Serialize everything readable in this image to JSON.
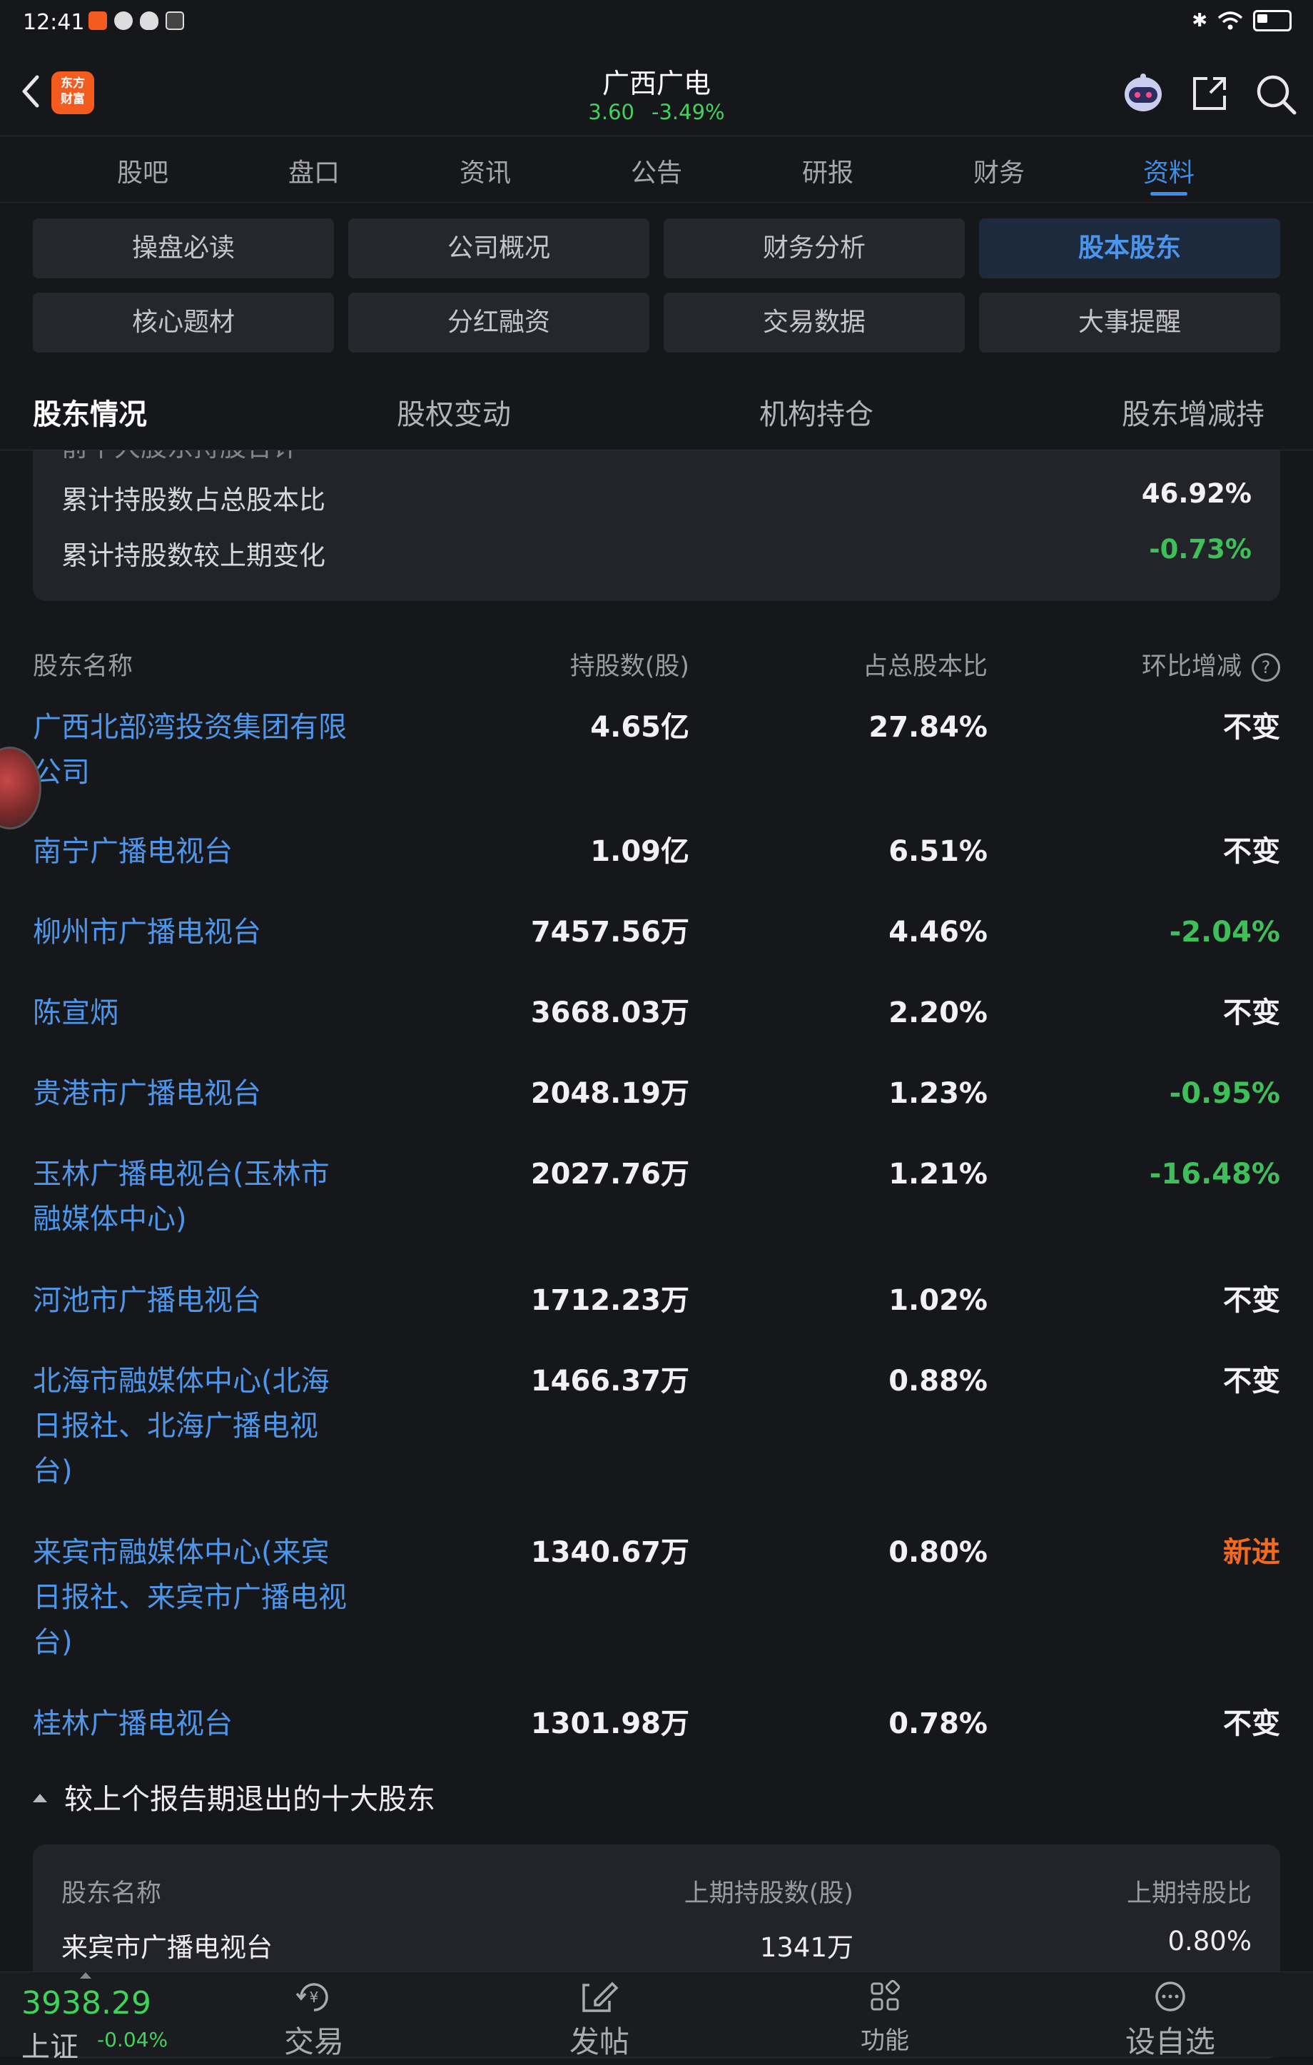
{
  "status_bar": {
    "time": "12:41"
  },
  "header": {
    "logo_text_1": "东方",
    "logo_text_2": "财富",
    "stock_name": "广西广电",
    "price": "3.60",
    "change_pct": "-3.49%"
  },
  "main_tabs": [
    "股吧",
    "盘口",
    "资讯",
    "公告",
    "研报",
    "财务",
    "资料"
  ],
  "main_tabs_active": "资料",
  "sub_buttons": [
    "操盘必读",
    "公司概况",
    "财务分析",
    "股本股东",
    "核心题材",
    "分红融资",
    "交易数据",
    "大事提醒"
  ],
  "sub_buttons_active": "股本股东",
  "section_tabs": [
    "股东情况",
    "股权变动",
    "机构持仓",
    "股东增减持"
  ],
  "section_tabs_active": "股东情况",
  "summary": [
    {
      "label": "前十大股东持股合计",
      "value": ""
    },
    {
      "label": "累计持股数占总股本比",
      "value": "46.92%"
    },
    {
      "label": "累计持股数较上期变化",
      "value": "-0.73%"
    }
  ],
  "table_headers": {
    "name": "股东名称",
    "shares": "持股数(股)",
    "ratio": "占总股本比",
    "change": "环比增减"
  },
  "holders": [
    {
      "name": "广西北部湾投资集团有限公司",
      "shares": "4.65亿",
      "ratio": "27.84%",
      "change": "不变"
    },
    {
      "name": "南宁广播电视台",
      "shares": "1.09亿",
      "ratio": "6.51%",
      "change": "不变"
    },
    {
      "name": "柳州市广播电视台",
      "shares": "7457.56万",
      "ratio": "4.46%",
      "change": "-2.04%"
    },
    {
      "name": "陈宣炳",
      "shares": "3668.03万",
      "ratio": "2.20%",
      "change": "不变"
    },
    {
      "name": "贵港市广播电视台",
      "shares": "2048.19万",
      "ratio": "1.23%",
      "change": "-0.95%"
    },
    {
      "name": "玉林广播电视台(玉林市融媒体中心)",
      "shares": "2027.76万",
      "ratio": "1.21%",
      "change": "-16.48%"
    },
    {
      "name": "河池市广播电视台",
      "shares": "1712.23万",
      "ratio": "1.02%",
      "change": "不变"
    },
    {
      "name": "北海市融媒体中心(北海日报社、北海广播电视台)",
      "shares": "1466.37万",
      "ratio": "0.88%",
      "change": "不变"
    },
    {
      "name": "来宾市融媒体中心(来宾日报社、来宾市广播电视台)",
      "shares": "1340.67万",
      "ratio": "0.80%",
      "change": "新进"
    },
    {
      "name": "桂林广播电视台",
      "shares": "1301.98万",
      "ratio": "0.78%",
      "change": "不变"
    }
  ],
  "exited": {
    "title": "较上个报告期退出的十大股东",
    "headers": {
      "name": "股东名称",
      "prev_shares": "上期持股数(股)",
      "prev_ratio": "上期持股比"
    },
    "rows": [
      {
        "name": "来宾市广播电视台",
        "prev_shares": "1341万",
        "prev_ratio": "0.80%"
      }
    ]
  },
  "bottom_bar": {
    "index_value": "3938.29",
    "index_name": "上证",
    "index_change": "-0.04%",
    "tabs": [
      "交易",
      "发帖",
      "功能",
      "设自选"
    ]
  },
  "colors": {
    "accent": "#3c8fe8",
    "up_green": "#3fd35c",
    "down_green": "#3fbf5a",
    "new_orange": "#f26a1e",
    "background": "#16171b"
  }
}
